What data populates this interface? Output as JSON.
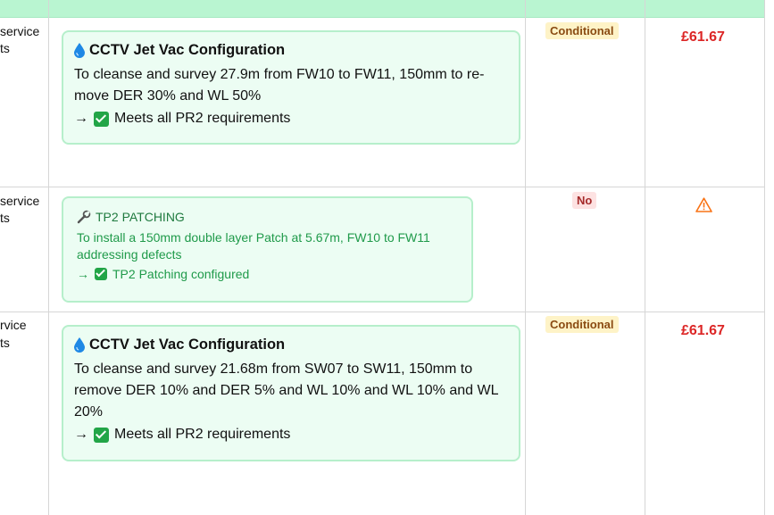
{
  "rows": [
    {
      "left_text": [
        "service",
        "ts"
      ],
      "card": {
        "style": "full",
        "icon": "water-drop-icon",
        "title": "CCTV Jet Vac Configuration",
        "description": "To cleanse and survey 27.9m from FW10 to FW11, 150mm to re-move DER 30% and WL 50%",
        "arrow": "→",
        "requirement": "Meets all PR2 requirements"
      },
      "status": "Conditional",
      "price": "£61.67"
    },
    {
      "left_text": [
        "service",
        "ts"
      ],
      "card": {
        "style": "patch",
        "icon": "wrench-icon",
        "title": "TP2 PATCHING",
        "description": "To install a 150mm double layer Patch at 5.67m, FW10 to FW11 addressing defects",
        "arrow": "→",
        "requirement": "TP2 Patching configured"
      },
      "status": "No",
      "price_icon": "warning-triangle-icon"
    },
    {
      "left_text": [
        "rvice",
        "ts"
      ],
      "card": {
        "style": "full",
        "icon": "water-drop-icon",
        "title": "CCTV Jet Vac Configuration",
        "description": "To cleanse and survey 21.68m from SW07 to SW11, 150mm to remove DER 10% and DER 5% and WL 10% and WL 10% and WL 20%",
        "arrow": "→",
        "requirement": "Meets all PR2 requirements"
      },
      "status": "Conditional",
      "price": "£61.67"
    }
  ],
  "colors": {
    "header_bg": "#b9f5d1",
    "card_bg": "#ecfdf3",
    "card_border": "#b6efcb",
    "price": "#dc2626",
    "conditional_bg": "#fef3c7",
    "no_bg": "#fde2e2",
    "check": "#22a547",
    "warning": "#f97316"
  }
}
